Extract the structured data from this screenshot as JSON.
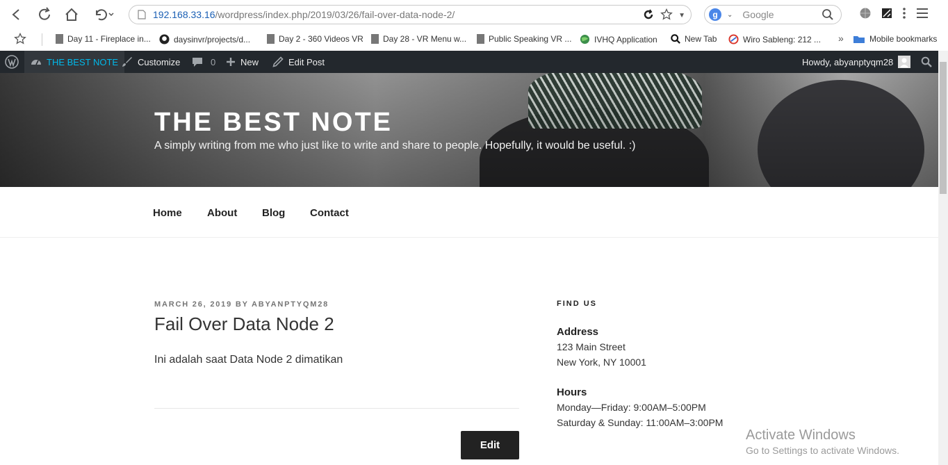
{
  "browser": {
    "url_host": "192.168.33.16",
    "url_path": "/wordpress/index.php/2019/03/26/fail-over-data-node-2/",
    "search_engine_letter": "g",
    "search_placeholder": "Google"
  },
  "bookmarks": [
    {
      "label": "Day 11 - Fireplace in..."
    },
    {
      "label": "daysinvr/projects/d..."
    },
    {
      "label": "Day 2 - 360 Videos VR"
    },
    {
      "label": "Day 28 - VR Menu w..."
    },
    {
      "label": "Public Speaking VR ..."
    },
    {
      "label": "IVHQ Application"
    },
    {
      "label": "New Tab"
    },
    {
      "label": "Wiro Sableng: 212 ..."
    }
  ],
  "bookmarks_overflow": "»",
  "mobile_bookmarks": "Mobile bookmarks",
  "adminbar": {
    "site": "THE BEST NOTE",
    "customize": "Customize",
    "comments_count": "0",
    "new": "New",
    "edit_post": "Edit Post",
    "howdy": "Howdy, abyanptyqm28"
  },
  "header": {
    "title": "THE BEST NOTE",
    "description": "A simply writing from me who just like to write and share to people. Hopefully, it would be useful. :)"
  },
  "menu": [
    "Home",
    "About",
    "Blog",
    "Contact"
  ],
  "post": {
    "date": "MARCH 26, 2019",
    "by": "BY",
    "author": "ABYANPTYQM28",
    "title": "Fail Over Data Node 2",
    "body": "Ini adalah saat Data Node 2 dimatikan",
    "edit_label": "Edit"
  },
  "sidebar": {
    "widget_title": "FIND US",
    "address_heading": "Address",
    "address_line1": "123 Main Street",
    "address_line2": "New York, NY 10001",
    "hours_heading": "Hours",
    "hours_line1": "Monday—Friday: 9:00AM–5:00PM",
    "hours_line2": "Saturday & Sunday: 11:00AM–3:00PM"
  },
  "watermark": {
    "line1": "Activate Windows",
    "line2": "Go to Settings to activate Windows."
  }
}
